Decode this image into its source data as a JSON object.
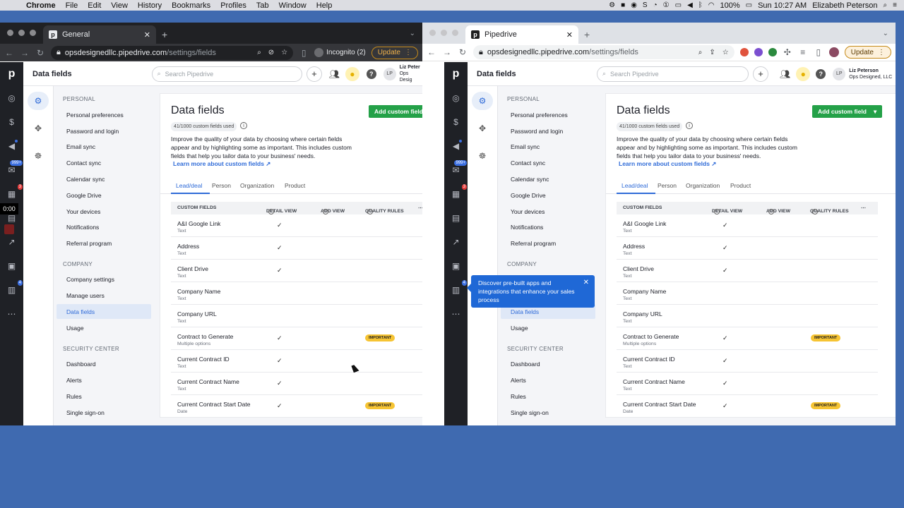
{
  "menubar": {
    "app": "Chrome",
    "items": [
      "File",
      "Edit",
      "View",
      "History",
      "Bookmarks",
      "Profiles",
      "Tab",
      "Window",
      "Help"
    ],
    "battery": "100%",
    "clock": "Sun 10:27 AM",
    "user": "Elizabeth Peterson"
  },
  "left_window": {
    "tab_title": "General",
    "url_host": "opsdesignedllc.pipedrive.com",
    "url_path": "/settings/fields",
    "incognito": "Incognito (2)",
    "update": "Update",
    "user_name": "Liz Peter",
    "user_company": "Ops Desig",
    "add_button": "Add custom field"
  },
  "right_window": {
    "tab_title": "Pipedrive",
    "url_host": "opsdesignedllc.pipedrive.com",
    "url_path": "/settings/fields",
    "update": "Update",
    "user_name": "Liz Peterson",
    "user_company": "Ops Designed, LLC",
    "add_button": "Add custom field"
  },
  "app": {
    "logo": "p",
    "page_title": "Data fields",
    "search_placeholder": "Search Pipedrive",
    "avatar": "LP",
    "badge_mail": "999+",
    "badge_activities": "3",
    "badge_marketplace": "4",
    "timer": "0:00"
  },
  "menu": {
    "personal_label": "PERSONAL",
    "personal": [
      "Personal preferences",
      "Password and login",
      "Email sync",
      "Contact sync",
      "Calendar sync",
      "Google Drive",
      "Your devices",
      "Notifications",
      "Referral program"
    ],
    "company_label": "COMPANY",
    "company": [
      "Company settings",
      "Manage users",
      "Data fields",
      "Usage"
    ],
    "security_label": "SECURITY CENTER",
    "security": [
      "Dashboard",
      "Alerts",
      "Rules",
      "Single sign-on"
    ]
  },
  "content": {
    "title": "Data fields",
    "used": "41/1000 custom fields used",
    "description": "Improve the quality of your data by choosing where certain fields appear and by highlighting some as important. This includes custom fields that help you tailor data to your business' needs.",
    "learn_more": "Learn more about custom fields ↗",
    "tabs": [
      "Lead/deal",
      "Person",
      "Organization",
      "Product"
    ],
    "columns": {
      "custom_fields": "CUSTOM FIELDS",
      "detail_view": "DETAIL VIEW",
      "add_view": "ADD VIEW",
      "quality_rules": "QUALITY RULES"
    },
    "important_label": "IMPORTANT",
    "rows": [
      {
        "name": "A&I Google Link",
        "type": "Text",
        "detail": "✓",
        "important": ""
      },
      {
        "name": "Address",
        "type": "Text",
        "detail": "✓",
        "important": ""
      },
      {
        "name": "Client Drive",
        "type": "Text",
        "detail": "✓",
        "important": ""
      },
      {
        "name": "Company Name",
        "type": "Text",
        "detail": "",
        "important": ""
      },
      {
        "name": "Company URL",
        "type": "Text",
        "detail": "",
        "important": ""
      },
      {
        "name": "Contract to Generate",
        "type": "Multiple options",
        "detail": "✓",
        "important": "IMPORTANT"
      },
      {
        "name": "Current Contract ID",
        "type": "Text",
        "detail": "✓",
        "important": ""
      },
      {
        "name": "Current Contract Name",
        "type": "Text",
        "detail": "✓",
        "important": ""
      },
      {
        "name": "Current Contract Start Date",
        "type": "Date",
        "detail": "✓",
        "important": "IMPORTANT"
      }
    ]
  },
  "popover": {
    "text": "Discover pre-built apps and integrations that enhance your sales process"
  }
}
